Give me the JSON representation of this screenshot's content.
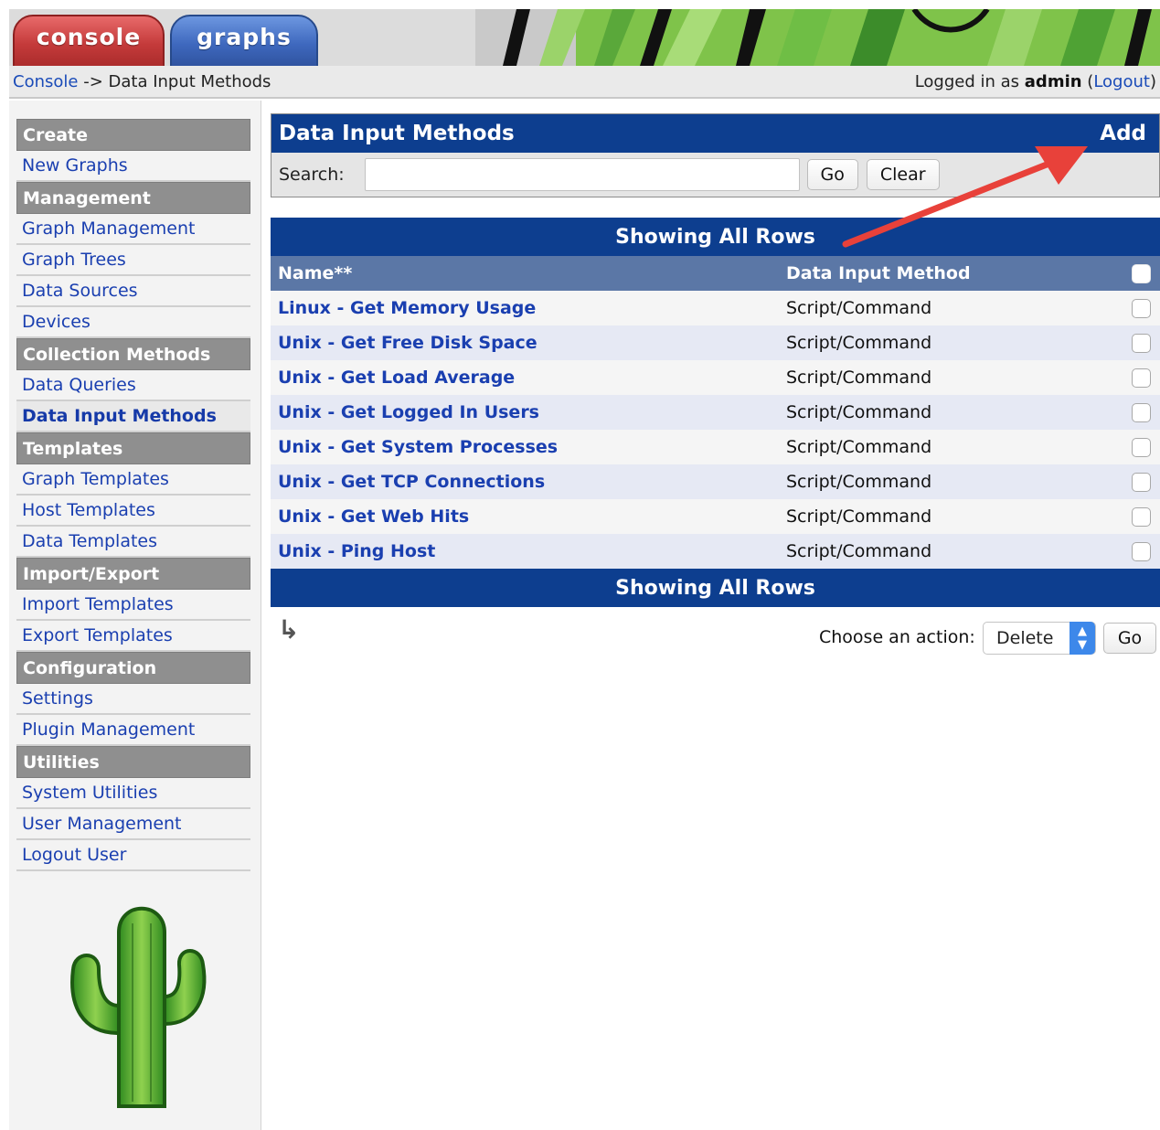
{
  "tabs": {
    "console": "console",
    "graphs": "graphs"
  },
  "breadcrumb": {
    "root": "Console",
    "separator": "->",
    "current": "Data Input Methods"
  },
  "login": {
    "prefix": "Logged in as",
    "user": "admin",
    "open": "(",
    "logout": "Logout",
    "close": ")"
  },
  "sidebar": {
    "sections": [
      {
        "title": "Create",
        "items": [
          {
            "label": "New Graphs"
          }
        ]
      },
      {
        "title": "Management",
        "items": [
          {
            "label": "Graph Management"
          },
          {
            "label": "Graph Trees"
          },
          {
            "label": "Data Sources"
          },
          {
            "label": "Devices"
          }
        ]
      },
      {
        "title": "Collection Methods",
        "items": [
          {
            "label": "Data Queries"
          },
          {
            "label": "Data Input Methods",
            "active": true
          }
        ]
      },
      {
        "title": "Templates",
        "items": [
          {
            "label": "Graph Templates"
          },
          {
            "label": "Host Templates"
          },
          {
            "label": "Data Templates"
          }
        ]
      },
      {
        "title": "Import/Export",
        "items": [
          {
            "label": "Import Templates"
          },
          {
            "label": "Export Templates"
          }
        ]
      },
      {
        "title": "Configuration",
        "items": [
          {
            "label": "Settings"
          },
          {
            "label": "Plugin Management"
          }
        ]
      },
      {
        "title": "Utilities",
        "items": [
          {
            "label": "System Utilities"
          },
          {
            "label": "User Management"
          },
          {
            "label": "Logout User"
          }
        ]
      }
    ]
  },
  "panel": {
    "title": "Data Input Methods",
    "add_label": "Add",
    "search_label": "Search:",
    "search_value": "",
    "go_label": "Go",
    "clear_label": "Clear"
  },
  "table": {
    "banner_top": "Showing All Rows",
    "banner_bottom": "Showing All Rows",
    "columns": {
      "name": "Name**",
      "method": "Data Input Method"
    },
    "rows": [
      {
        "name": "Linux - Get Memory Usage",
        "method": "Script/Command"
      },
      {
        "name": "Unix - Get Free Disk Space",
        "method": "Script/Command"
      },
      {
        "name": "Unix - Get Load Average",
        "method": "Script/Command"
      },
      {
        "name": "Unix - Get Logged In Users",
        "method": "Script/Command"
      },
      {
        "name": "Unix - Get System Processes",
        "method": "Script/Command"
      },
      {
        "name": "Unix - Get TCP Connections",
        "method": "Script/Command"
      },
      {
        "name": "Unix - Get Web Hits",
        "method": "Script/Command"
      },
      {
        "name": "Unix - Ping Host",
        "method": "Script/Command"
      }
    ]
  },
  "actions": {
    "label": "Choose an action:",
    "selected": "Delete",
    "go_label": "Go"
  },
  "colors": {
    "header_blue": "#0d3e8f",
    "column_header": "#5b77a6",
    "link": "#1a3fb0",
    "annotation_arrow": "#e8413a"
  },
  "icons": {
    "return": "return-arrow-icon",
    "annotation": "red-arrow-annotation"
  }
}
